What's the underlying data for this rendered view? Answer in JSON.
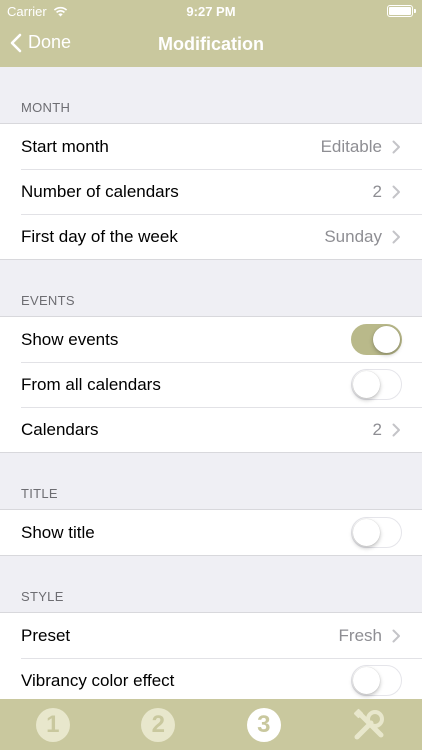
{
  "status_bar": {
    "carrier": "Carrier",
    "time": "9:27 PM"
  },
  "nav": {
    "back_label": "Done",
    "title": "Modification"
  },
  "sections": [
    {
      "header": "MONTH",
      "rows": [
        {
          "label": "Start month",
          "value": "Editable",
          "type": "disclosure"
        },
        {
          "label": "Number of calendars",
          "value": "2",
          "type": "disclosure"
        },
        {
          "label": "First day of the week",
          "value": "Sunday",
          "type": "disclosure"
        }
      ]
    },
    {
      "header": "EVENTS",
      "rows": [
        {
          "label": "Show events",
          "type": "toggle",
          "on": true
        },
        {
          "label": "From all calendars",
          "type": "toggle",
          "on": false
        },
        {
          "label": "Calendars",
          "value": "2",
          "type": "disclosure"
        }
      ]
    },
    {
      "header": "TITLE",
      "rows": [
        {
          "label": "Show title",
          "type": "toggle",
          "on": false
        }
      ]
    },
    {
      "header": "STYLE",
      "rows": [
        {
          "label": "Preset",
          "value": "Fresh",
          "type": "disclosure"
        },
        {
          "label": "Vibrancy color effect",
          "type": "toggle",
          "on": false
        }
      ]
    }
  ],
  "tabbar": {
    "tabs": [
      {
        "label": "1",
        "active": false
      },
      {
        "label": "2",
        "active": false
      },
      {
        "label": "3",
        "active": true
      },
      {
        "icon": "tools-icon",
        "active": false
      }
    ]
  },
  "colors": {
    "bar": "#c9c89e",
    "toggle_on": "#b9b98a",
    "background": "#efeff4"
  }
}
